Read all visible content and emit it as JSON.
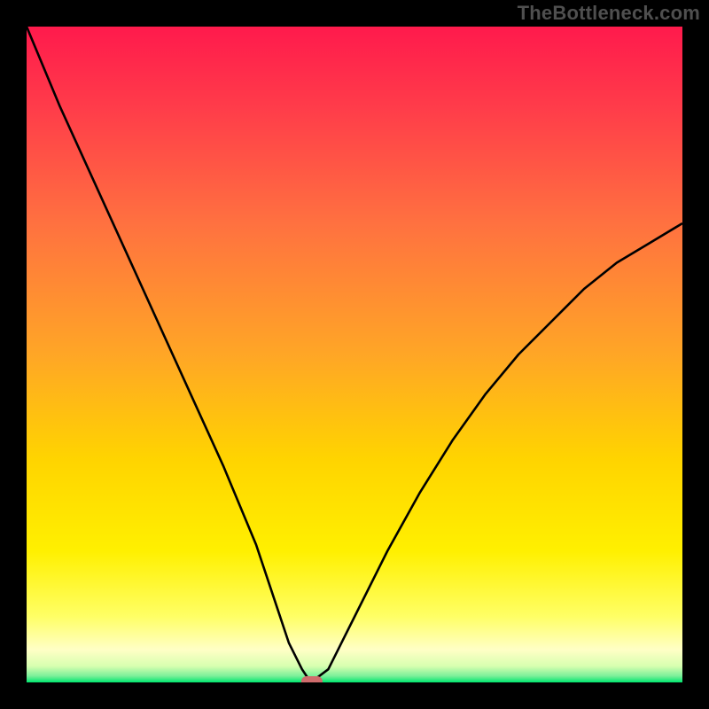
{
  "watermark": "TheBottleneck.com",
  "chart_data": {
    "type": "line",
    "title": "",
    "xlabel": "",
    "ylabel": "",
    "xlim": [
      0,
      100
    ],
    "ylim": [
      0,
      100
    ],
    "grid": false,
    "legend": false,
    "series": [
      {
        "name": "bottleneck-curve",
        "x": [
          0,
          5,
          10,
          15,
          20,
          25,
          30,
          35,
          38,
          40,
          42,
          43,
          44,
          46,
          48,
          50,
          55,
          60,
          65,
          70,
          75,
          80,
          85,
          90,
          95,
          100
        ],
        "y": [
          100,
          88,
          77,
          66,
          55,
          44,
          33,
          21,
          12,
          6,
          2,
          0.5,
          0.5,
          2,
          6,
          10,
          20,
          29,
          37,
          44,
          50,
          55,
          60,
          64,
          67,
          70
        ]
      }
    ],
    "marker": {
      "x": 43.5,
      "y": 0,
      "color": "#cf6b6c",
      "shape": "rounded-rect"
    },
    "gradient_stops": [
      {
        "offset": 0.0,
        "color": "#ff1a4c"
      },
      {
        "offset": 0.12,
        "color": "#ff3b4a"
      },
      {
        "offset": 0.3,
        "color": "#ff7140"
      },
      {
        "offset": 0.5,
        "color": "#ffa626"
      },
      {
        "offset": 0.66,
        "color": "#ffd400"
      },
      {
        "offset": 0.8,
        "color": "#fff000"
      },
      {
        "offset": 0.9,
        "color": "#ffff66"
      },
      {
        "offset": 0.95,
        "color": "#ffffc6"
      },
      {
        "offset": 0.975,
        "color": "#d8ffb0"
      },
      {
        "offset": 0.99,
        "color": "#7df09a"
      },
      {
        "offset": 1.0,
        "color": "#00e56e"
      }
    ]
  }
}
